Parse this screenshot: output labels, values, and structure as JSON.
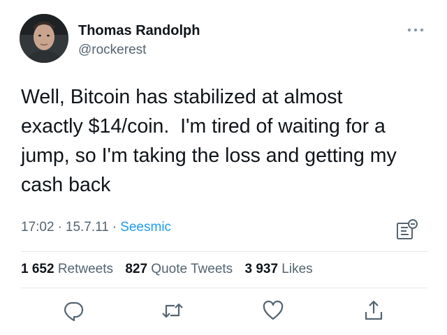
{
  "author": {
    "display_name": "Thomas Randolph",
    "handle": "@rockerest"
  },
  "tweet": {
    "text": "Well, Bitcoin has stabilized at almost\nexactly $14/coin.  I'm tired of waiting for a\njump, so I'm taking the loss and getting my\ncash back"
  },
  "meta": {
    "time": "17:02",
    "separator": "·",
    "date": "15.7.11",
    "source": "Seesmic"
  },
  "stats": {
    "retweets": {
      "count": "1 652",
      "label": "Retweets"
    },
    "quote_tweets": {
      "count": "827",
      "label": "Quote Tweets"
    },
    "likes": {
      "count": "3 937",
      "label": "Likes"
    }
  },
  "icons": {
    "more": "more-horizontal-icon",
    "analytics": "analytics-icon",
    "reply": "reply-icon",
    "retweet": "retweet-icon",
    "like": "heart-icon",
    "share": "share-icon"
  },
  "colors": {
    "text": "#0f1419",
    "secondary": "#536471",
    "link": "#1d9bf0",
    "divider": "#e4e8eb"
  }
}
